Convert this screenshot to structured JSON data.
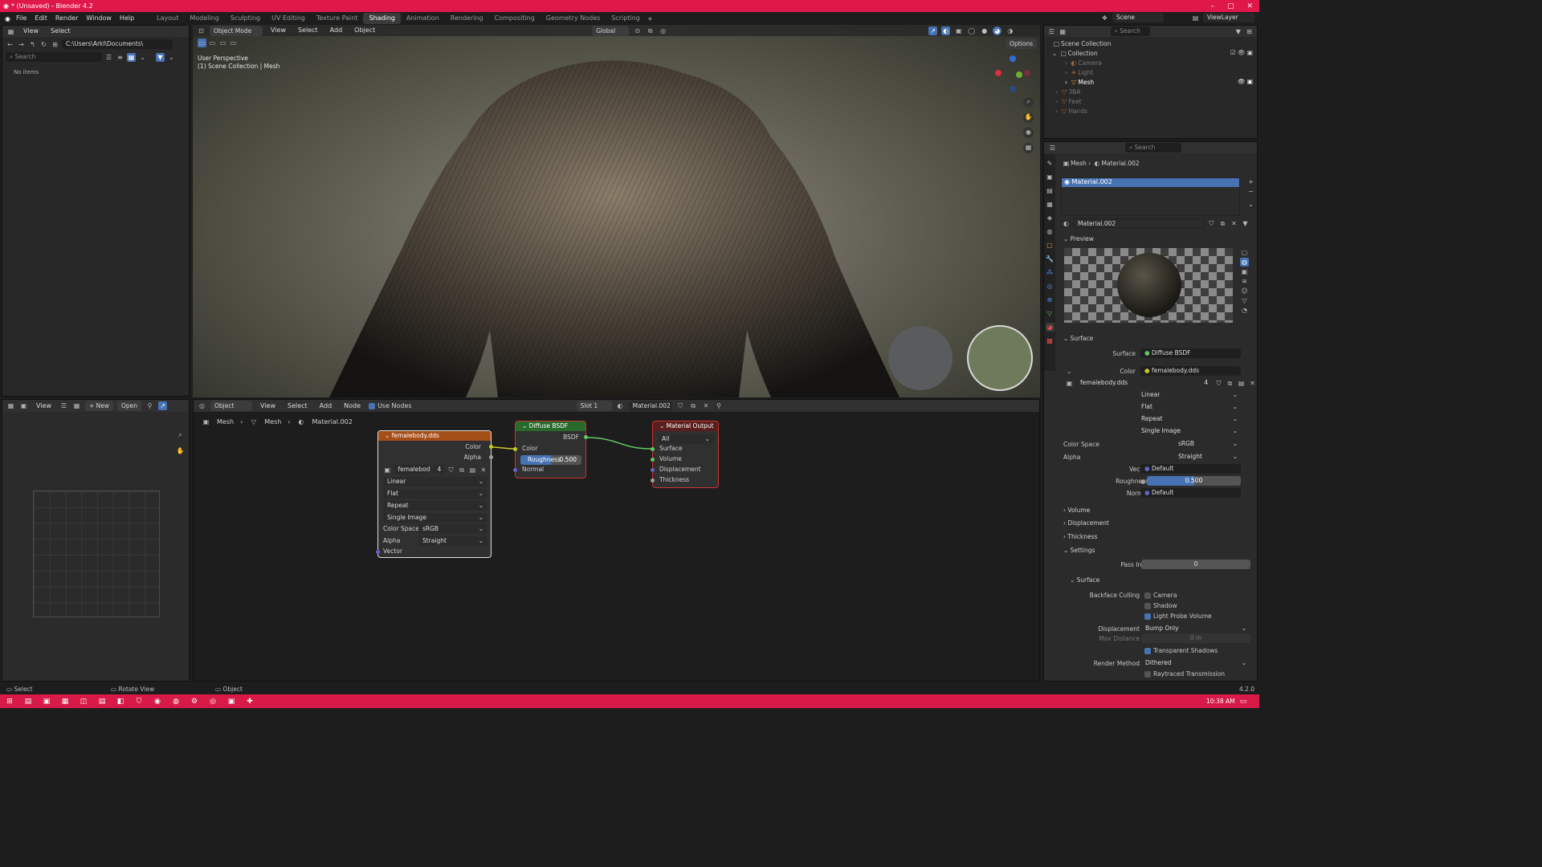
{
  "window": {
    "title": "* (Unsaved) - Blender 4.2",
    "min": "–",
    "max": "▢",
    "close": "✕"
  },
  "menu": [
    "File",
    "Edit",
    "Render",
    "Window",
    "Help"
  ],
  "workspaces": [
    "Layout",
    "Modeling",
    "Sculpting",
    "UV Editing",
    "Texture Paint",
    "Shading",
    "Animation",
    "Rendering",
    "Compositing",
    "Geometry Nodes",
    "Scripting"
  ],
  "active_workspace": "Shading",
  "scene": {
    "name": "Scene",
    "view_layer": "ViewLayer"
  },
  "file_browser": {
    "view": "View",
    "select": "Select",
    "path": "C:\\Users\\Arkl\\Documents\\",
    "search": "Search",
    "empty": "No items"
  },
  "viewport": {
    "mode": "Object Mode",
    "menus": [
      "View",
      "Select",
      "Add",
      "Object"
    ],
    "orientation": "Global",
    "options": "Options",
    "info1": "User Perspective",
    "info2": "(1) Scene Collection | Mesh"
  },
  "image_editor": {
    "view": "View",
    "new": "New",
    "open": "Open"
  },
  "node_editor": {
    "object": "Object",
    "menus": [
      "View",
      "Select",
      "Add",
      "Node"
    ],
    "use_nodes": "Use Nodes",
    "slot": "Slot 1",
    "material": "Material.002",
    "breadcrumb": [
      "Mesh",
      "Mesh",
      "Material.002"
    ]
  },
  "nodes": {
    "tex": {
      "title": "femalebody.dds",
      "out_color": "Color",
      "out_alpha": "Alpha",
      "image": "femalebody...",
      "users": "4",
      "interp": "Linear",
      "proj": "Flat",
      "ext": "Repeat",
      "source": "Single Image",
      "cs_label": "Color Space",
      "cs": "sRGB",
      "alpha_label": "Alpha",
      "alpha": "Straight",
      "vector": "Vector"
    },
    "bsdf": {
      "title": "Diffuse BSDF",
      "out": "BSDF",
      "color": "Color",
      "rough_label": "Roughness",
      "rough": "0.500",
      "normal": "Normal"
    },
    "out": {
      "title": "Material Output",
      "target": "All",
      "surface": "Surface",
      "volume": "Volume",
      "displacement": "Displacement",
      "thickness": "Thickness"
    }
  },
  "outliner": {
    "search": "Search",
    "root": "Scene Collection",
    "items": [
      "Collection",
      "Camera",
      "Light",
      "Mesh",
      "3BA",
      "Feet",
      "Hands"
    ]
  },
  "properties": {
    "search": "Search",
    "breadcrumb": [
      "Mesh",
      "Material.002"
    ],
    "slot": "Material.002",
    "material": "Material.002",
    "preview": "Preview",
    "surface_panel": "Surface",
    "surface_label": "Surface",
    "surface_val": "Diffuse BSDF",
    "color_label": "Color",
    "color_val": "femalebody.dds",
    "image": "femalebody.dds",
    "image_users": "4",
    "interp": "Linear",
    "proj": "Flat",
    "ext": "Repeat",
    "source": "Single Image",
    "cs_label": "Color Space",
    "cs": "sRGB",
    "alpha_label": "Alpha",
    "alpha": "Straight",
    "vector_label": "Vector",
    "vector": "Default",
    "rough_label": "Roughness",
    "rough": "0.500",
    "normal_label": "Normal",
    "normal": "Default",
    "volume": "Volume",
    "displacement": "Displacement",
    "thickness": "Thickness",
    "settings": "Settings",
    "pass_label": "Pass Index",
    "pass": "0",
    "surface_sub": "Surface",
    "backface_label": "Backface Culling",
    "camera": "Camera",
    "shadow": "Shadow",
    "lpv": "Light Probe Volume",
    "disp_label": "Displacement",
    "disp": "Bump Only",
    "maxd_label": "Max Distance",
    "maxd": "0 m",
    "trans_shadows": "Transparent Shadows",
    "render_label": "Render Method",
    "render": "Dithered",
    "rt": "Raytraced Transmission"
  },
  "status": {
    "select": "Select",
    "rotate": "Rotate View",
    "object": "Object",
    "version": "4.2.0"
  },
  "taskbar": {
    "time": "10:38 AM"
  }
}
